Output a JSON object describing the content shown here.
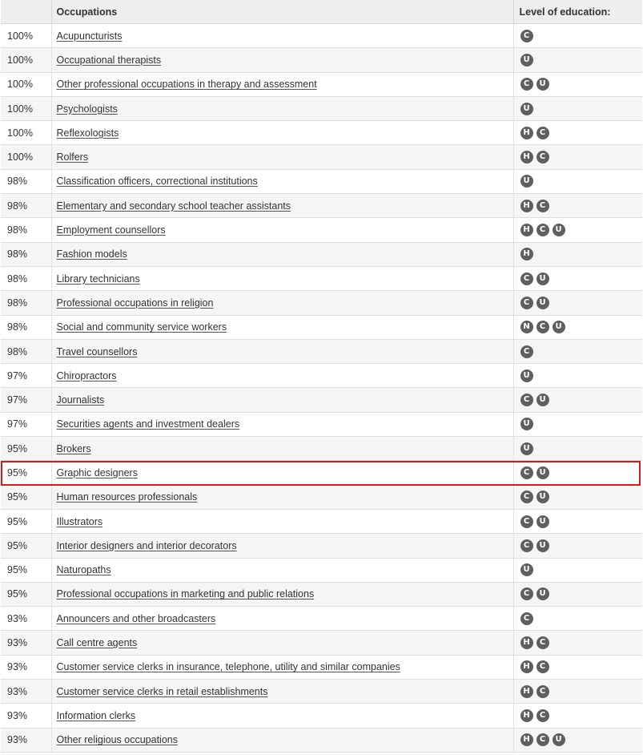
{
  "table": {
    "headers": {
      "percent": "",
      "occupations": "Occupations",
      "education": "Level of education:"
    },
    "highlight_color": "#d7191c",
    "badge_color": "#5f5f5f",
    "rows": [
      {
        "percent": "100%",
        "occupation": "Acupuncturists",
        "education": [
          "C"
        ]
      },
      {
        "percent": "100%",
        "occupation": "Occupational therapists",
        "education": [
          "U"
        ]
      },
      {
        "percent": "100%",
        "occupation": "Other professional occupations in therapy and assessment",
        "education": [
          "C",
          "U"
        ]
      },
      {
        "percent": "100%",
        "occupation": "Psychologists",
        "education": [
          "U"
        ]
      },
      {
        "percent": "100%",
        "occupation": "Reflexologists",
        "education": [
          "H",
          "C"
        ]
      },
      {
        "percent": "100%",
        "occupation": "Rolfers",
        "education": [
          "H",
          "C"
        ]
      },
      {
        "percent": "98%",
        "occupation": "Classification officers, correctional institutions",
        "education": [
          "U"
        ]
      },
      {
        "percent": "98%",
        "occupation": "Elementary and secondary school teacher assistants",
        "education": [
          "H",
          "C"
        ]
      },
      {
        "percent": "98%",
        "occupation": "Employment counsellors",
        "education": [
          "H",
          "C",
          "U"
        ]
      },
      {
        "percent": "98%",
        "occupation": "Fashion models",
        "education": [
          "H"
        ]
      },
      {
        "percent": "98%",
        "occupation": "Library technicians",
        "education": [
          "C",
          "U"
        ]
      },
      {
        "percent": "98%",
        "occupation": "Professional occupations in religion",
        "education": [
          "C",
          "U"
        ]
      },
      {
        "percent": "98%",
        "occupation": "Social and community service workers",
        "education": [
          "N",
          "C",
          "U"
        ]
      },
      {
        "percent": "98%",
        "occupation": "Travel counsellors",
        "education": [
          "C"
        ]
      },
      {
        "percent": "97%",
        "occupation": "Chiropractors",
        "education": [
          "U"
        ]
      },
      {
        "percent": "97%",
        "occupation": "Journalists",
        "education": [
          "C",
          "U"
        ]
      },
      {
        "percent": "97%",
        "occupation": "Securities agents and investment dealers",
        "education": [
          "U"
        ]
      },
      {
        "percent": "95%",
        "occupation": "Brokers",
        "education": [
          "U"
        ]
      },
      {
        "percent": "95%",
        "occupation": "Graphic designers",
        "education": [
          "C",
          "U"
        ],
        "highlighted": true
      },
      {
        "percent": "95%",
        "occupation": "Human resources professionals",
        "education": [
          "C",
          "U"
        ]
      },
      {
        "percent": "95%",
        "occupation": "Illustrators",
        "education": [
          "C",
          "U"
        ]
      },
      {
        "percent": "95%",
        "occupation": "Interior designers and interior decorators",
        "education": [
          "C",
          "U"
        ]
      },
      {
        "percent": "95%",
        "occupation": "Naturopaths",
        "education": [
          "U"
        ]
      },
      {
        "percent": "95%",
        "occupation": "Professional occupations in marketing and public relations",
        "education": [
          "C",
          "U"
        ]
      },
      {
        "percent": "93%",
        "occupation": "Announcers and other broadcasters",
        "education": [
          "C"
        ]
      },
      {
        "percent": "93%",
        "occupation": "Call centre agents",
        "education": [
          "H",
          "C"
        ]
      },
      {
        "percent": "93%",
        "occupation": "Customer service clerks in insurance, telephone, utility and similar companies",
        "education": [
          "H",
          "C"
        ]
      },
      {
        "percent": "93%",
        "occupation": "Customer service clerks in retail establishments",
        "education": [
          "H",
          "C"
        ]
      },
      {
        "percent": "93%",
        "occupation": "Information clerks",
        "education": [
          "H",
          "C"
        ]
      },
      {
        "percent": "93%",
        "occupation": "Other religious occupations",
        "education": [
          "H",
          "C",
          "U"
        ]
      }
    ]
  }
}
